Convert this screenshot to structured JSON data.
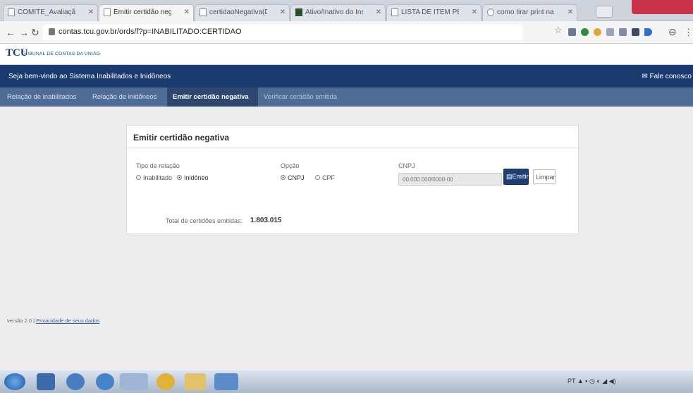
{
  "browser": {
    "tabs": [
      {
        "label": "COMITE_Avaliação_x"
      },
      {
        "label": "Emitir certidão negativa"
      },
      {
        "label": "certidaoNegativa(Dúvid"
      },
      {
        "label": "Ativo/Inativo do Instr"
      },
      {
        "label": "LISTA DE ITEM PEF(M"
      },
      {
        "label": "como tirar print na p"
      }
    ],
    "url": "contas.tcu.gov.br/ords/f?p=INABILITADO:CERTIDAO"
  },
  "site": {
    "logo": "TCU",
    "logo_text": "TRIBUNAL DE CONTAS DA UNIÃO"
  },
  "banner": {
    "welcome": "Seja bem-vindo ao Sistema Inabilitados e Inidôneos",
    "contact": "Fale conosco"
  },
  "nav": {
    "items": [
      "Relação de inabilitados",
      "Relação de inidôneos",
      "Emitir certidão negativa",
      "Verificar certidão emitida"
    ]
  },
  "form": {
    "title": "Emitir certidão negativa",
    "relation_label": "Tipo de relação",
    "relation_options": [
      "Inabilitado",
      "Inidôneo"
    ],
    "relation_selected": "Inidôneo",
    "option_label": "Opção",
    "option_options": [
      "CNPJ",
      "CPF"
    ],
    "option_selected": "CNPJ",
    "cnpj_label": "CNPJ",
    "cnpj_placeholder": "00.000.000/0000-00",
    "emit_button": "Emitir",
    "clear_button": "Limpar",
    "total_label": "Total de certidões emitidas:",
    "total_value": "1.803.015"
  },
  "footer": {
    "version": "versão 2.0",
    "privacy_link": "Privacidade de seus dados"
  }
}
